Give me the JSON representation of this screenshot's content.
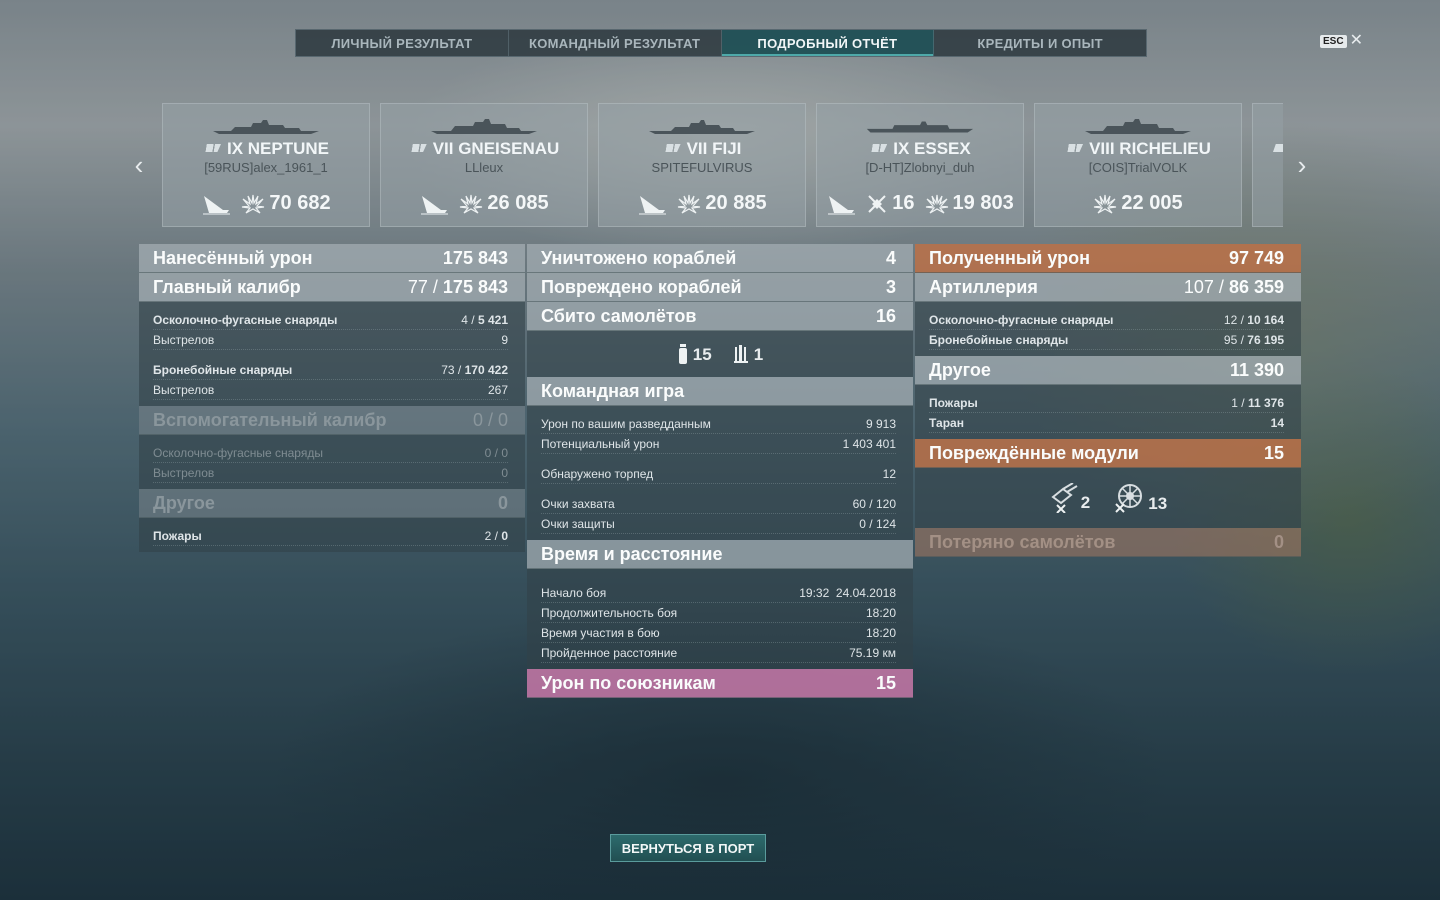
{
  "tabs": [
    {
      "label": "ЛИЧНЫЙ РЕЗУЛЬТАТ"
    },
    {
      "label": "КОМАНДНЫЙ РЕЗУЛЬТАТ"
    },
    {
      "label": "ПОДРОБНЫЙ ОТЧЁТ"
    },
    {
      "label": "КРЕДИТЫ И ОПЫТ"
    }
  ],
  "esc": {
    "key": "ESC",
    "close": "✕"
  },
  "carousel": {
    "prev": "‹",
    "next": "›"
  },
  "ships": [
    {
      "name": "IX NEPTUNE",
      "player": "[59RUS]alex_1961_1",
      "damage": "70 682",
      "kills": ""
    },
    {
      "name": "VII GNEISENAU",
      "player": "LLleux",
      "damage": "26 085",
      "kills": ""
    },
    {
      "name": "VII FIJI",
      "player": "SPITEFULVIRUS",
      "damage": "20 885",
      "kills": ""
    },
    {
      "name": "IX ESSEX",
      "player": "[D-HT]Zlobnyi_duh",
      "damage": "19 803",
      "kills": "16"
    },
    {
      "name": "VIII RICHELIEU",
      "player": "[COIS]TrialVOLK",
      "damage": "22 005",
      "kills": ""
    }
  ],
  "left": {
    "dealt": {
      "label": "Нанесённый урон",
      "value": "175 843"
    },
    "main": {
      "label": "Главный калибр",
      "a": "77",
      "b": "175 843"
    },
    "main_rows": [
      {
        "label": "Осколочно-фугасные снаряды",
        "a": "4",
        "b": "5 421"
      },
      {
        "label": "Выстрелов",
        "value": "9"
      },
      {
        "label": "Бронебойные снаряды",
        "a": "73",
        "b": "170 422"
      },
      {
        "label": "Выстрелов",
        "value": "267"
      }
    ],
    "secondary": {
      "label": "Вспомогательный калибр",
      "a": "0",
      "b": "0"
    },
    "secondary_rows": [
      {
        "label": "Осколочно-фугасные снаряды",
        "a": "0",
        "b": "0"
      },
      {
        "label": "Выстрелов",
        "value": "0"
      }
    ],
    "other": {
      "label": "Другое",
      "value": "0"
    },
    "other_rows": [
      {
        "label": "Пожары",
        "a": "2",
        "b": "0"
      }
    ]
  },
  "mid": {
    "destroyed": {
      "label": "Уничтожено кораблей",
      "value": "4"
    },
    "damaged": {
      "label": "Повреждено кораблей",
      "value": "3"
    },
    "planes": {
      "label": "Сбито самолётов",
      "value": "16"
    },
    "planes_icons": {
      "fighters": "15",
      "bombers": "1"
    },
    "team": {
      "label": "Командная игра"
    },
    "team_rows": [
      {
        "label": "Урон по вашим разведданным",
        "value": "9 913"
      },
      {
        "label": "Потенциальный урон",
        "value": "1 403 401"
      },
      {
        "label": "Обнаружено торпед",
        "value": "12"
      },
      {
        "label": "Очки захвата",
        "value": "60 / 120"
      },
      {
        "label": "Очки защиты",
        "value": "0 / 124"
      }
    ],
    "time": {
      "label": "Время и расстояние"
    },
    "time_rows": [
      {
        "label": "Начало боя",
        "value": "19:32  24.04.2018"
      },
      {
        "label": "Продолжительность боя",
        "value": "18:20"
      },
      {
        "label": "Время участия в бою",
        "value": "18:20"
      },
      {
        "label": "Пройденное расстояние",
        "value": "75.19 км"
      }
    ],
    "ally": {
      "label": "Урон по союзникам",
      "value": "15"
    }
  },
  "right": {
    "received": {
      "label": "Полученный урон",
      "value": "97 749"
    },
    "artillery": {
      "label": "Артиллерия",
      "a": "107",
      "b": "86 359"
    },
    "artillery_rows": [
      {
        "label": "Осколочно-фугасные снаряды",
        "a": "12",
        "b": "10 164"
      },
      {
        "label": "Бронебойные снаряды",
        "a": "95",
        "b": "76 195"
      }
    ],
    "other": {
      "label": "Другое",
      "value": "11 390"
    },
    "other_rows": [
      {
        "label": "Пожары",
        "a": "1",
        "b": "11 376"
      },
      {
        "label": "Таран",
        "value": "14"
      }
    ],
    "modules": {
      "label": "Повреждённые модули",
      "value": "15"
    },
    "modules_icons": {
      "guns": "2",
      "steering": "13"
    },
    "lost": {
      "label": "Потеряно самолётов",
      "value": "0"
    }
  },
  "footer": {
    "return_label": "ВЕРНУТЬСЯ В ПОРТ"
  }
}
